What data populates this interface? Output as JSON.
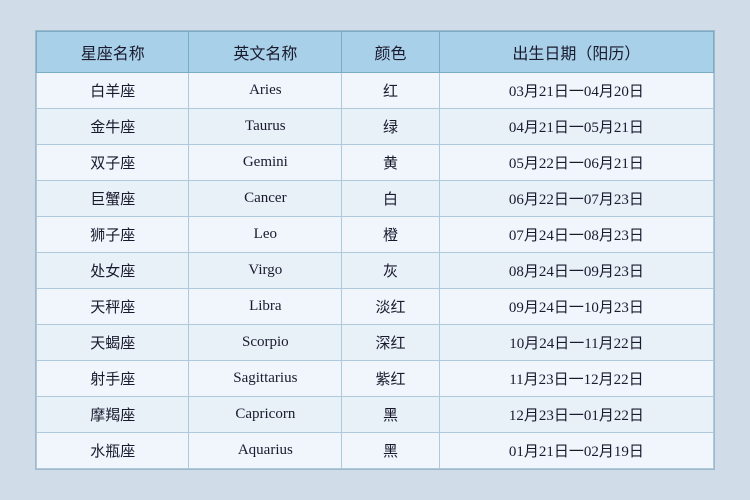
{
  "table": {
    "headers": [
      "星座名称",
      "英文名称",
      "颜色",
      "出生日期（阳历）"
    ],
    "rows": [
      {
        "chinese": "白羊座",
        "english": "Aries",
        "color": "红",
        "date": "03月21日一04月20日"
      },
      {
        "chinese": "金牛座",
        "english": "Taurus",
        "color": "绿",
        "date": "04月21日一05月21日"
      },
      {
        "chinese": "双子座",
        "english": "Gemini",
        "color": "黄",
        "date": "05月22日一06月21日"
      },
      {
        "chinese": "巨蟹座",
        "english": "Cancer",
        "color": "白",
        "date": "06月22日一07月23日"
      },
      {
        "chinese": "狮子座",
        "english": "Leo",
        "color": "橙",
        "date": "07月24日一08月23日"
      },
      {
        "chinese": "处女座",
        "english": "Virgo",
        "color": "灰",
        "date": "08月24日一09月23日"
      },
      {
        "chinese": "天秤座",
        "english": "Libra",
        "color": "淡红",
        "date": "09月24日一10月23日"
      },
      {
        "chinese": "天蝎座",
        "english": "Scorpio",
        "color": "深红",
        "date": "10月24日一11月22日"
      },
      {
        "chinese": "射手座",
        "english": "Sagittarius",
        "color": "紫红",
        "date": "11月23日一12月22日"
      },
      {
        "chinese": "摩羯座",
        "english": "Capricorn",
        "color": "黑",
        "date": "12月23日一01月22日"
      },
      {
        "chinese": "水瓶座",
        "english": "Aquarius",
        "color": "黑",
        "date": "01月21日一02月19日"
      }
    ]
  }
}
